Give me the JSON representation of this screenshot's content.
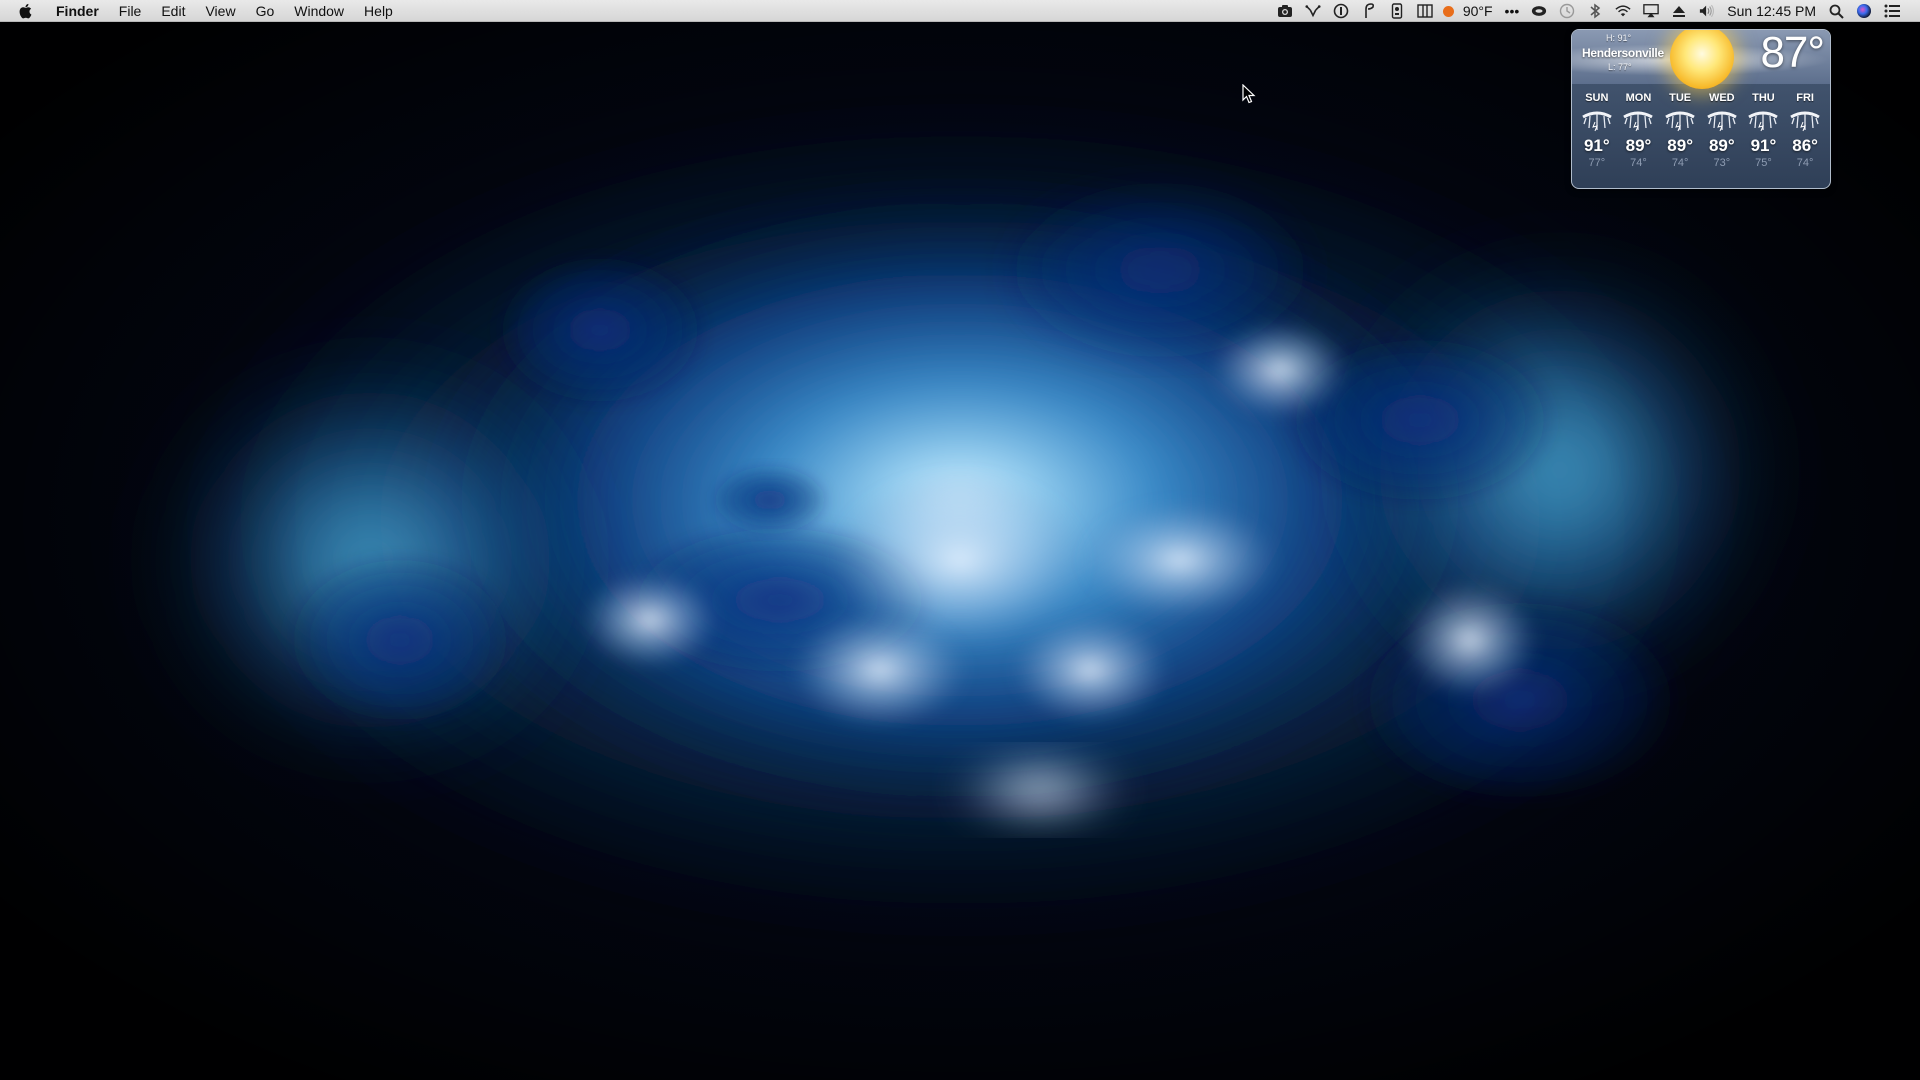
{
  "menubar": {
    "app_name": "Finder",
    "menus": [
      "File",
      "Edit",
      "View",
      "Go",
      "Window",
      "Help"
    ],
    "status": {
      "temperature": "90°F",
      "more": "•••",
      "clock": "Sun 12:45 PM"
    },
    "icons": [
      "apple-icon",
      "camera-icon",
      "tool-icon",
      "info-circle-icon",
      "pen-icon",
      "timer-icon",
      "columns-icon",
      "temperature-dot-icon",
      "more-dots-icon",
      "cloud-eye-icon",
      "time-machine-icon",
      "bluetooth-icon",
      "wifi-icon",
      "airplay-icon",
      "eject-icon",
      "volume-icon",
      "search-icon",
      "siri-icon",
      "notification-list-icon"
    ]
  },
  "weather": {
    "city": "Hendersonville",
    "high": "H: 91°",
    "low": "L: 77°",
    "current": "87°",
    "days": [
      {
        "name": "SUN",
        "high": "91°",
        "low": "77°",
        "icon": "thunderstorm-icon"
      },
      {
        "name": "MON",
        "high": "89°",
        "low": "74°",
        "icon": "thunderstorm-icon"
      },
      {
        "name": "TUE",
        "high": "89°",
        "low": "74°",
        "icon": "thunderstorm-icon"
      },
      {
        "name": "WED",
        "high": "89°",
        "low": "73°",
        "icon": "thunderstorm-icon"
      },
      {
        "name": "THU",
        "high": "91°",
        "low": "75°",
        "icon": "thunderstorm-icon"
      },
      {
        "name": "FRI",
        "high": "86°",
        "low": "74°",
        "icon": "thunderstorm-icon"
      }
    ]
  },
  "colors": {
    "menubar_bg": "#e0e0e0",
    "wallpaper_glow": "#5fb8e8",
    "wallpaper_deep": "#0a3a8a",
    "temp_dot": "#e86d1a"
  }
}
